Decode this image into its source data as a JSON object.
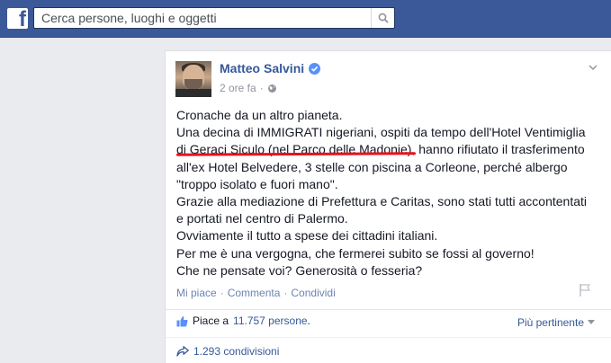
{
  "header": {
    "logo": "f",
    "search_placeholder": "Cerca persone, luoghi e oggetti",
    "search_icon": "search-icon"
  },
  "post": {
    "author": "Matteo Salvini",
    "time": "2 ore fa",
    "separator": "·",
    "body_lines": [
      "Cronache da un altro pianeta.",
      "Una decina di IMMIGRATI nigeriani, ospiti da tempo dell'Hotel Ventimiglia",
      "di Geraci Siculo (nel Parco delle Madonie), hanno rifiutato il trasferimento",
      "all'ex Hotel Belvedere, 3 stelle con piscina a Corleone, perché albergo",
      "\"troppo isolato e fuori mano\".",
      "Grazie alla mediazione di Prefettura e Caritas, sono stati tutti accontentati",
      "e portati nel centro di Palermo.",
      "Ovviamente il tutto a spese dei cittadini italiani.",
      "Per me è una vergogna, che fermerei subito se fossi al governo!",
      "Che ne pensate voi? Generosità o fesseria?"
    ],
    "actions": {
      "like": "Mi piace",
      "comment": "Commenta",
      "share": "Condividi",
      "sep": "·"
    },
    "likes": {
      "prefix": "Piace a",
      "count": "11.757 persone",
      "suffix": "."
    },
    "sort_label": "Più pertinente",
    "shares": "1.293 condivisioni"
  },
  "colors": {
    "brand": "#3b5998",
    "link": "#365899",
    "highlight": "#e8111c"
  }
}
